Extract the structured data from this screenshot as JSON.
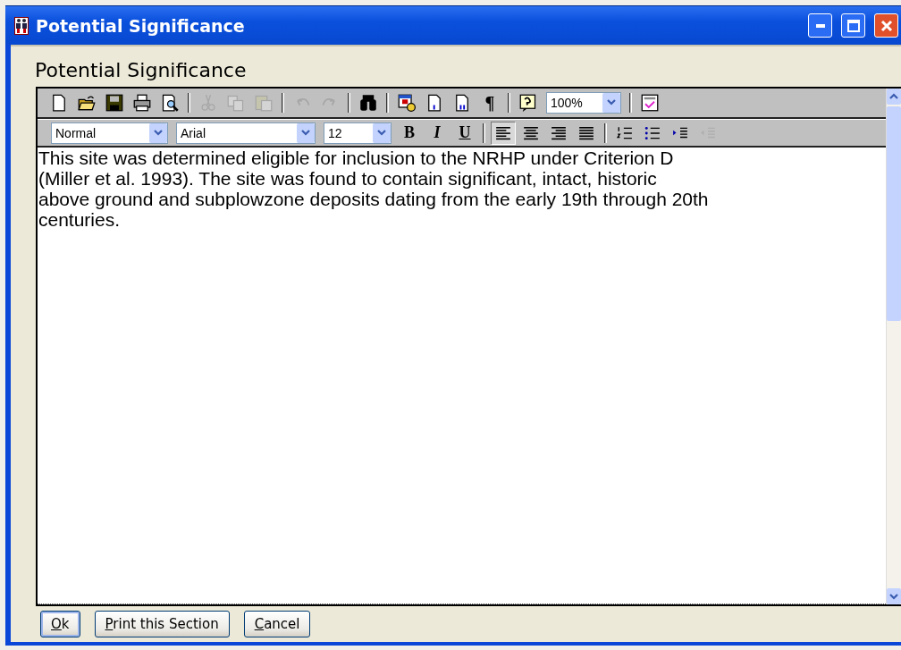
{
  "window": {
    "title": "Potential Significance"
  },
  "heading": "Potential Significance",
  "toolbar_1": [
    {
      "kind": "new",
      "disabled": false
    },
    {
      "kind": "open",
      "disabled": false
    },
    {
      "kind": "save",
      "disabled": false
    },
    {
      "kind": "print",
      "disabled": false
    },
    {
      "kind": "preview",
      "disabled": false
    },
    {
      "kind": "separator"
    },
    {
      "kind": "cut",
      "disabled": true
    },
    {
      "kind": "copy",
      "disabled": true
    },
    {
      "kind": "paste",
      "disabled": true
    },
    {
      "kind": "separator"
    },
    {
      "kind": "undo",
      "disabled": true
    },
    {
      "kind": "redo",
      "disabled": true
    },
    {
      "kind": "separator"
    },
    {
      "kind": "find",
      "disabled": false
    },
    {
      "kind": "separator"
    },
    {
      "kind": "date",
      "disabled": false
    },
    {
      "kind": "page-number",
      "disabled": false
    },
    {
      "kind": "page-count",
      "disabled": false
    },
    {
      "kind": "pilcrow",
      "text": "¶"
    },
    {
      "kind": "separator"
    },
    {
      "kind": "help",
      "disabled": false
    },
    {
      "kind": "zoom-select",
      "value": "100%"
    },
    {
      "kind": "separator"
    },
    {
      "kind": "spell",
      "disabled": false
    }
  ],
  "toolbar_2": [
    {
      "kind": "style-select",
      "value": "Normal"
    },
    {
      "kind": "font-select",
      "value": "Arial"
    },
    {
      "kind": "size-select",
      "value": "12"
    },
    {
      "kind": "bold",
      "text": "B"
    },
    {
      "kind": "italic",
      "text": "I"
    },
    {
      "kind": "underline",
      "text": "U"
    },
    {
      "kind": "separator"
    },
    {
      "kind": "align-left",
      "selected": true
    },
    {
      "kind": "align-center",
      "selected": false
    },
    {
      "kind": "align-right",
      "selected": false
    },
    {
      "kind": "align-justify",
      "selected": false
    },
    {
      "kind": "separator"
    },
    {
      "kind": "numbered-list",
      "disabled": false
    },
    {
      "kind": "bulleted-list",
      "disabled": false
    },
    {
      "kind": "indent",
      "disabled": false
    },
    {
      "kind": "outdent",
      "disabled": true
    }
  ],
  "body_text": "This site was determined eligible for inclusion to the NRHP under Criterion D\n(Miller et al. 1993). The site was found to contain significant, intact, historic\nabove ground and subplowzone deposits dating from the early 19th through 20th\ncenturies.",
  "buttons": [
    {
      "label": "Ok",
      "default": true
    },
    {
      "label": "Print this Section",
      "default": false
    },
    {
      "label": "Cancel",
      "default": false
    }
  ]
}
